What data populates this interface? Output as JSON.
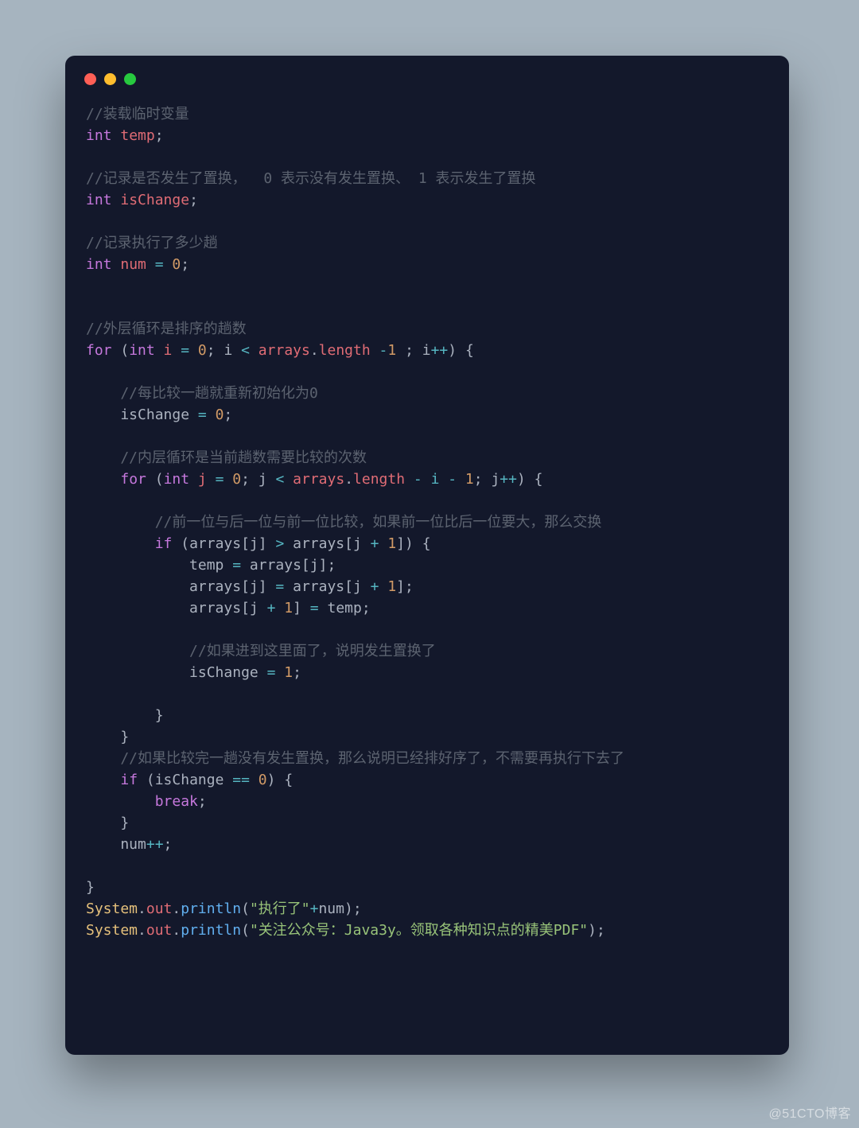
{
  "watermark": "@51CTO博客",
  "code": {
    "c1": "//装载临时变量",
    "l1a": "int",
    "l1b": " temp",
    "l1c": ";",
    "c2": "//记录是否发生了置换，  0 表示没有发生置换、 1 表示发生了置换",
    "l2a": "int",
    "l2b": " isChange",
    "l2c": ";",
    "c3": "//记录执行了多少趟",
    "l3a": "int",
    "l3b": " num ",
    "l3c": "=",
    "l3d": " 0",
    "l3e": ";",
    "c4": "//外层循环是排序的趟数",
    "l4a": "for",
    "l4b": " (",
    "l4c": "int",
    "l4d": " i ",
    "l4e": "=",
    "l4f": " 0",
    "l4g": "; i ",
    "l4h": "<",
    "l4i": " arrays",
    "l4j": ".",
    "l4k": "length",
    "l4l": " -",
    "l4m": "1",
    "l4n": " ; i",
    "l4o": "++",
    "l4p": ") {",
    "c5": "    //每比较一趟就重新初始化为0",
    "l5a": "    isChange ",
    "l5b": "=",
    "l5c": " 0",
    "l5d": ";",
    "c6": "    //内层循环是当前趟数需要比较的次数",
    "l6a": "    ",
    "l6b": "for",
    "l6c": " (",
    "l6d": "int",
    "l6e": " j ",
    "l6f": "=",
    "l6g": " 0",
    "l6h": "; j ",
    "l6i": "<",
    "l6j": " arrays",
    "l6k": ".",
    "l6l": "length",
    "l6m": " - i - ",
    "l6n": "1",
    "l6o": "; j",
    "l6p": "++",
    "l6q": ") {",
    "c7": "        //前一位与后一位与前一位比较，如果前一位比后一位要大，那么交换",
    "l7a": "        ",
    "l7b": "if",
    "l7c": " (arrays[j] ",
    "l7d": ">",
    "l7e": " arrays[j ",
    "l7f": "+",
    "l7g": " 1",
    "l7h": "]) {",
    "l8a": "            temp ",
    "l8b": "=",
    "l8c": " arrays[j];",
    "l9a": "            arrays[j] ",
    "l9b": "=",
    "l9c": " arrays[j ",
    "l9d": "+",
    "l9e": " 1",
    "l9f": "];",
    "l10a": "            arrays[j ",
    "l10b": "+",
    "l10c": " 1",
    "l10d": "] ",
    "l10e": "=",
    "l10f": " temp;",
    "c8": "            //如果进到这里面了，说明发生置换了",
    "l11a": "            isChange ",
    "l11b": "=",
    "l11c": " 1",
    "l11d": ";",
    "l12": "        }",
    "l13": "    }",
    "c9": "    //如果比较完一趟没有发生置换，那么说明已经排好序了，不需要再执行下去了",
    "l14a": "    ",
    "l14b": "if",
    "l14c": " (isChange ",
    "l14d": "==",
    "l14e": " 0",
    "l14f": ") {",
    "l15a": "        ",
    "l15b": "break",
    "l15c": ";",
    "l16": "    }",
    "l17a": "    num",
    "l17b": "++",
    "l17c": ";",
    "l18": "}",
    "l19a": "System",
    "l19b": ".",
    "l19c": "out",
    "l19d": ".",
    "l19e": "println",
    "l19f": "(",
    "l19g": "\"执行了\"",
    "l19h": "+",
    "l19i": "num);",
    "l20a": "System",
    "l20b": ".",
    "l20c": "out",
    "l20d": ".",
    "l20e": "println",
    "l20f": "(",
    "l20g": "\"关注公众号：Java3y。领取各种知识点的精美PDF\"",
    "l20h": ");"
  }
}
